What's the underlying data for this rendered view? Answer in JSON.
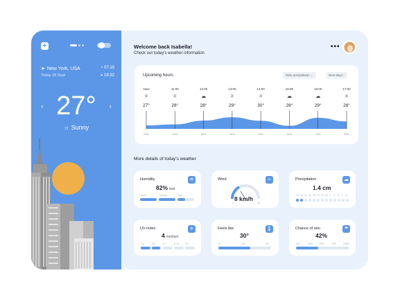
{
  "sidebar": {
    "location": "New York, USA",
    "date": "Today 28 Sept",
    "sunrise": "07:19",
    "sunset": "19:32",
    "temperature": "27°",
    "condition": "Sunny"
  },
  "header": {
    "welcome": "Welcome back Isabella!",
    "subtitle": "Check out today's weather information",
    "more_label": "•••"
  },
  "hours": {
    "title": "Upcoming hours",
    "filter": "Rain precipitation ⌄",
    "next_days": "Next days ›",
    "items": [
      {
        "time": "Now",
        "icon": "sun-icon",
        "temp": "27°",
        "precip": "23%"
      },
      {
        "time": "11:00",
        "icon": "sun-icon",
        "temp": "28°",
        "precip": "29%"
      },
      {
        "time": "12:00",
        "icon": "cloud-icon",
        "temp": "28°",
        "precip": "54%"
      },
      {
        "time": "13:00",
        "icon": "sun-icon",
        "temp": "29°",
        "precip": "76%"
      },
      {
        "time": "14:00",
        "icon": "sun-icon",
        "temp": "30°",
        "precip": "53%"
      },
      {
        "time": "15:00",
        "icon": "cloud-icon",
        "temp": "28°",
        "precip": "20%"
      },
      {
        "time": "16:00",
        "icon": "cloud-icon",
        "temp": "29°",
        "precip": "73%"
      },
      {
        "time": "17:00",
        "icon": "sun-icon",
        "temp": "28°",
        "precip": "49%"
      }
    ],
    "precip_values": [
      23,
      29,
      54,
      76,
      53,
      20,
      73,
      49
    ]
  },
  "details": {
    "title": "More details of today's weather",
    "humidity": {
      "label": "Humidity",
      "value": "82%",
      "unit": "bad",
      "scale": [
        "good",
        "normal",
        "bad"
      ],
      "level": 0.82
    },
    "wind": {
      "label": "Wind",
      "value": "8 km/h",
      "min": "0",
      "max": "40",
      "level": 0.2
    },
    "precipitation": {
      "label": "Precipitation",
      "value": "1.4 cm",
      "ticks": [
        "10",
        "12",
        "14",
        "16",
        "18",
        "20",
        "22",
        "24",
        "1",
        "3",
        "5",
        "7",
        "9"
      ],
      "filled": 2
    },
    "uv": {
      "label": "UV index",
      "value": "4",
      "unit": "medium",
      "scale": [
        "0-2",
        "3-5",
        "6-7",
        "8-10",
        "11+"
      ],
      "level": 0.36
    },
    "feels": {
      "label": "Feels like",
      "value": "30°",
      "scale": [
        "0°",
        "25°",
        "50°"
      ],
      "level": 0.6
    },
    "rain": {
      "label": "Chance of rain",
      "value": "42%",
      "scale": [
        "0%",
        "25%",
        "50%",
        "75%",
        "100%"
      ],
      "level": 0.42
    }
  },
  "colors": {
    "accent": "#5b97e6",
    "sun": "#efb04a",
    "panel": "#e8f1fc"
  }
}
